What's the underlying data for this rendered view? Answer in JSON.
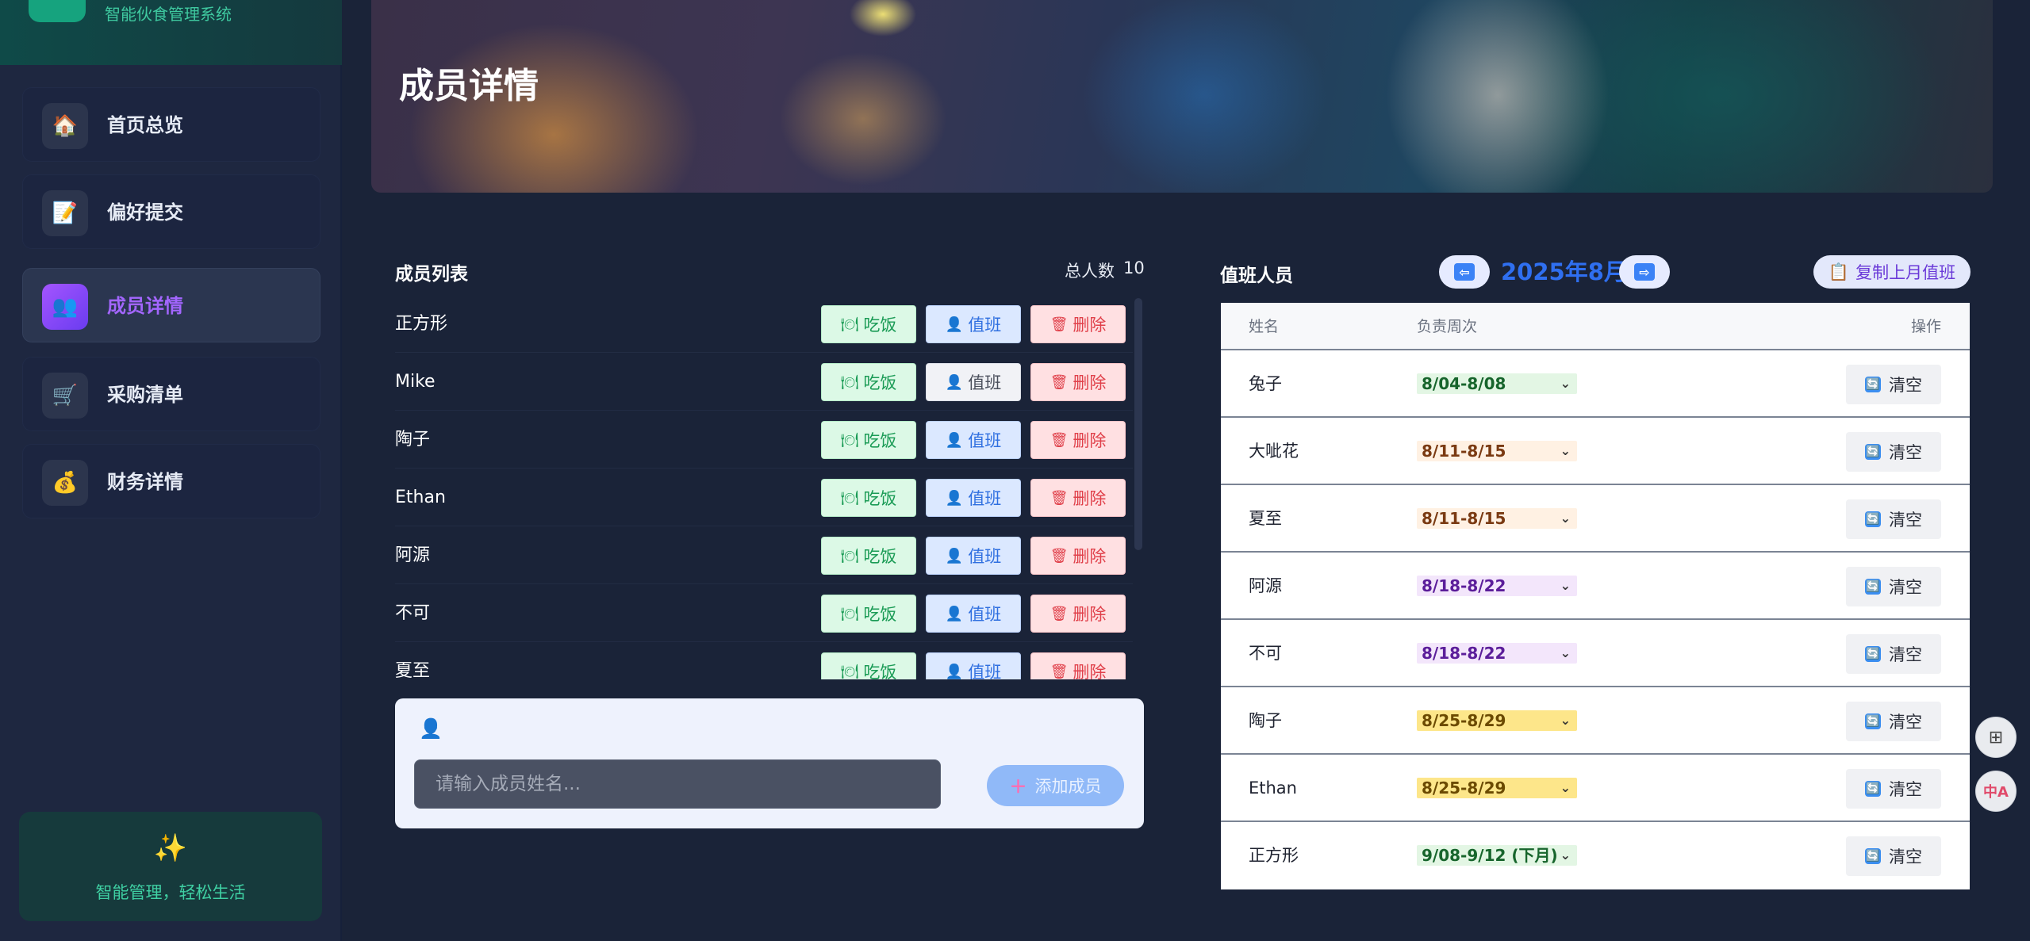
{
  "sidebar": {
    "brand_subtitle": "智能伙食管理系统",
    "nav": [
      {
        "label": "首页总览",
        "icon": "🏠",
        "icon_name": "home-icon",
        "active": false
      },
      {
        "label": "偏好提交",
        "icon": "📝",
        "icon_name": "memo-icon",
        "active": false
      },
      {
        "label": "成员详情",
        "icon": "👥",
        "icon_name": "users-icon",
        "active": true
      },
      {
        "label": "采购清单",
        "icon": "🛒",
        "icon_name": "cart-icon",
        "active": false
      },
      {
        "label": "财务详情",
        "icon": "💰",
        "icon_name": "money-bag-icon",
        "active": false
      }
    ],
    "promo": {
      "icon": "✨",
      "text": "智能管理，轻松生活"
    }
  },
  "page": {
    "title": "成员详情"
  },
  "members": {
    "title": "成员列表",
    "count_label": "总人数",
    "count": "10",
    "eat_label": "吃饭",
    "duty_label": "值班",
    "delete_label": "删除",
    "eat_icon": "🍽",
    "duty_icon": "👤",
    "delete_icon": "🗑",
    "rows": [
      {
        "name": "正方形",
        "on_duty": true
      },
      {
        "name": "Mike",
        "on_duty": false
      },
      {
        "name": "陶子",
        "on_duty": true
      },
      {
        "name": "Ethan",
        "on_duty": true
      },
      {
        "name": "阿源",
        "on_duty": true
      },
      {
        "name": "不可",
        "on_duty": true
      },
      {
        "name": "夏至",
        "on_duty": true
      }
    ]
  },
  "add_member": {
    "icon": "👤",
    "placeholder": "请输入成员姓名...",
    "button_label": "添加成员",
    "button_icon": "＋"
  },
  "duty": {
    "title": "值班人员",
    "month": "2025年8月",
    "prev_icon": "⇦",
    "next_icon": "⇨",
    "copy_label": "复制上月值班",
    "copy_icon": "📋",
    "columns": {
      "name": "姓名",
      "week": "负责周次",
      "action": "操作"
    },
    "clear_label": "清空",
    "clear_icon": "🔄",
    "rows": [
      {
        "name": "兔子",
        "week": "8/04-8/08",
        "bg": "#e3f6e4",
        "fg": "#17652c"
      },
      {
        "name": "大呲花",
        "week": "8/11-8/15",
        "bg": "#fff1e3",
        "fg": "#7a3a12"
      },
      {
        "name": "夏至",
        "week": "8/11-8/15",
        "bg": "#fff1e3",
        "fg": "#7a3a12"
      },
      {
        "name": "阿源",
        "week": "8/18-8/22",
        "bg": "#f3e6fb",
        "fg": "#5b1d9a"
      },
      {
        "name": "不可",
        "week": "8/18-8/22",
        "bg": "#f3e6fb",
        "fg": "#5b1d9a"
      },
      {
        "name": "陶子",
        "week": "8/25-8/29",
        "bg": "#fde68a",
        "fg": "#6b4a00"
      },
      {
        "name": "Ethan",
        "week": "8/25-8/29",
        "bg": "#fde68a",
        "fg": "#6b4a00"
      },
      {
        "name": "正方形",
        "week": "9/08-9/12 (下月)",
        "bg": "#e3f6e4",
        "fg": "#17652c"
      }
    ]
  },
  "float_tools": [
    {
      "icon": "⊞",
      "icon_name": "apps-icon"
    },
    {
      "icon": "中A",
      "icon_name": "translate-icon"
    }
  ]
}
